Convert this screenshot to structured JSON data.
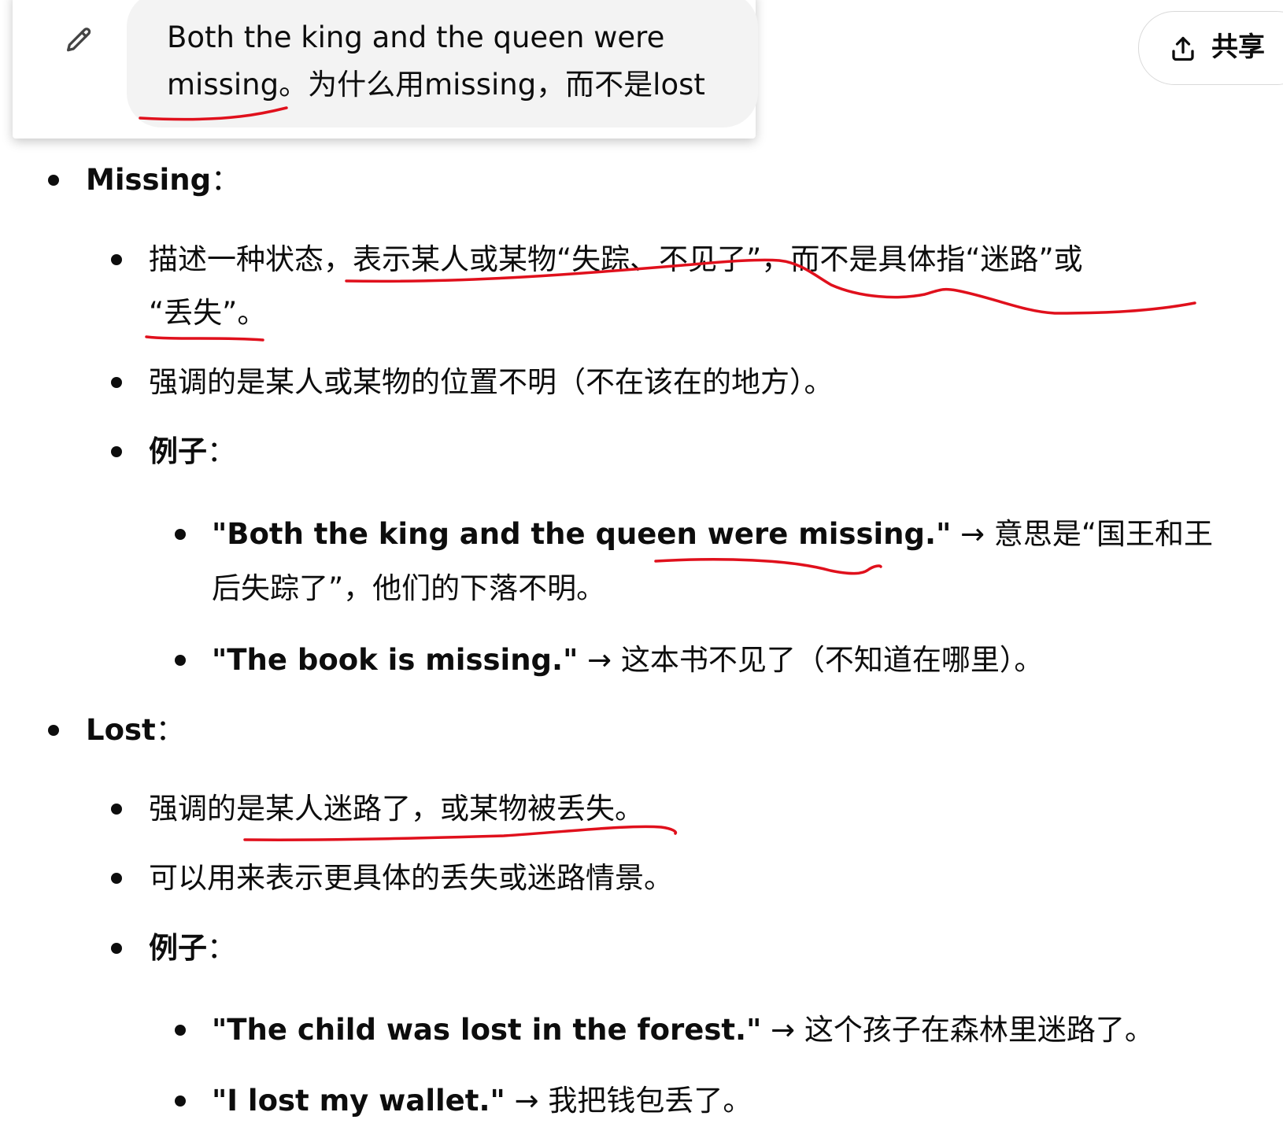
{
  "header": {
    "edit_icon": "pencil-icon",
    "user_message_line1": "Both the king and the queen were",
    "user_message_line2": "missing。为什么用missing，而不是lost",
    "share_icon": "share-upload-icon",
    "share_label": "共享"
  },
  "answer": {
    "missing": {
      "term": "Missing",
      "colon": "：",
      "point1_line1": "描述一种状态，表示某人或某物“失踪、不见了”，而不是具体指“迷路”或",
      "point1_line2": "“丢失”。",
      "point2": "强调的是某人或某物的位置不明（不在该在的地方）。",
      "examples_label": "例子",
      "examples_colon": "：",
      "ex1_en": "\"Both the king and the queen were missing.\"",
      "ex1_zh_line1": " → 意思是“国王和王",
      "ex1_zh_line2": "后失踪了”，他们的下落不明。",
      "ex2_en": "\"The book is missing.\"",
      "ex2_zh": " → 这本书不见了（不知道在哪里）。"
    },
    "lost": {
      "term": "Lost",
      "colon": "：",
      "point1": "强调的是某人迷路了，或某物被丢失。",
      "point2": "可以用来表示更具体的丢失或迷路情景。",
      "examples_label": "例子",
      "examples_colon": "：",
      "ex1_en": "\"The child was lost in the forest.\"",
      "ex1_zh": " → 这个孩子在森林里迷路了。",
      "ex2_en": "\"I lost my wallet.\"",
      "ex2_zh": " → 我把钱包丢了。"
    }
  },
  "colors": {
    "text": "#0d0d0d",
    "bubble_bg": "#f3f3f3",
    "annotation_red": "#e0101c"
  }
}
